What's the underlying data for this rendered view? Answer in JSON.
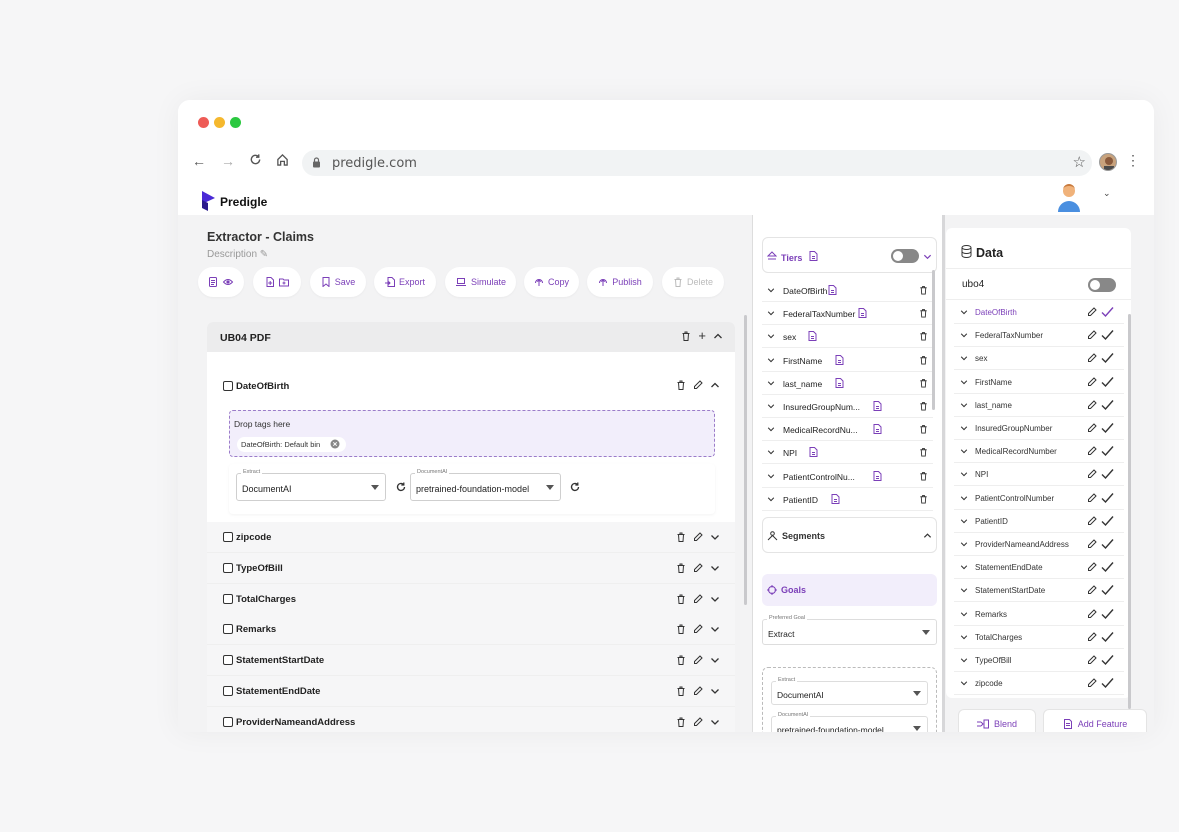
{
  "browser": {
    "url": "predigle.com",
    "traffic_lights": [
      "#ee5b56",
      "#f5b82e",
      "#2bc840"
    ]
  },
  "app": {
    "brand": "Predigle",
    "brand_color": "#7b3fb8",
    "logo_color": "#4a2ad6"
  },
  "left": {
    "title": "Extractor - Claims",
    "description": "Description ✎",
    "toolbar": [
      {
        "label": "",
        "icon": "doc-eye-icon"
      },
      {
        "label": "",
        "icon": "add-file-folder-icon"
      },
      {
        "label": "Save",
        "icon": "bookmark-icon"
      },
      {
        "label": "Export",
        "icon": "export-icon"
      },
      {
        "label": "Simulate",
        "icon": "laptop-icon"
      },
      {
        "label": "Copy",
        "icon": "copy-icon"
      },
      {
        "label": "Publish",
        "icon": "publish-icon"
      },
      {
        "label": "Delete",
        "icon": "trash-icon",
        "disabled": true
      }
    ],
    "section_title": "UB04 PDF",
    "expanded_field": "DateOfBirth",
    "dropzone_label": "Drop tags here",
    "chip": "DateOfBirth: Default bin",
    "extract_caption": "Extract",
    "extract_value": "DocumentAI",
    "model_caption": "DocumentAI",
    "model_value": "pretrained-foundation-model",
    "fields": [
      "zipcode",
      "TypeOfBill",
      "TotalCharges",
      "Remarks",
      "StatementStartDate",
      "StatementEndDate",
      "ProviderNameandAddress"
    ]
  },
  "middle": {
    "tiers_label": "Tiers",
    "tiers": [
      "DateOfBirth",
      "FederalTaxNumber",
      "sex",
      "FirstName",
      "last_name",
      "InsuredGroupNum...",
      "MedicalRecordNu...",
      "NPI",
      "PatientControlNu...",
      "PatientID"
    ],
    "segments_label": "Segments",
    "goals_label": "Goals",
    "preferred_goal_caption": "Preferred Goal",
    "preferred_goal_value": "Extract",
    "extract_caption": "Extract",
    "extract_value": "DocumentAI",
    "model_caption": "DocumentAI",
    "model_value": "pretrained-foundation-model"
  },
  "right": {
    "title": "Data",
    "ubo_label": "ubo4",
    "items": [
      "DateOfBirth",
      "FederalTaxNumber",
      "sex",
      "FirstName",
      "last_name",
      "InsuredGroupNumber",
      "MedicalRecordNumber",
      "NPI",
      "PatientControlNumber",
      "PatientID",
      "ProviderNameandAddress",
      "StatementEndDate",
      "StatementStartDate",
      "Remarks",
      "TotalCharges",
      "TypeOfBill",
      "zipcode"
    ],
    "blend_label": "Blend",
    "add_feature_label": "Add Feature"
  }
}
